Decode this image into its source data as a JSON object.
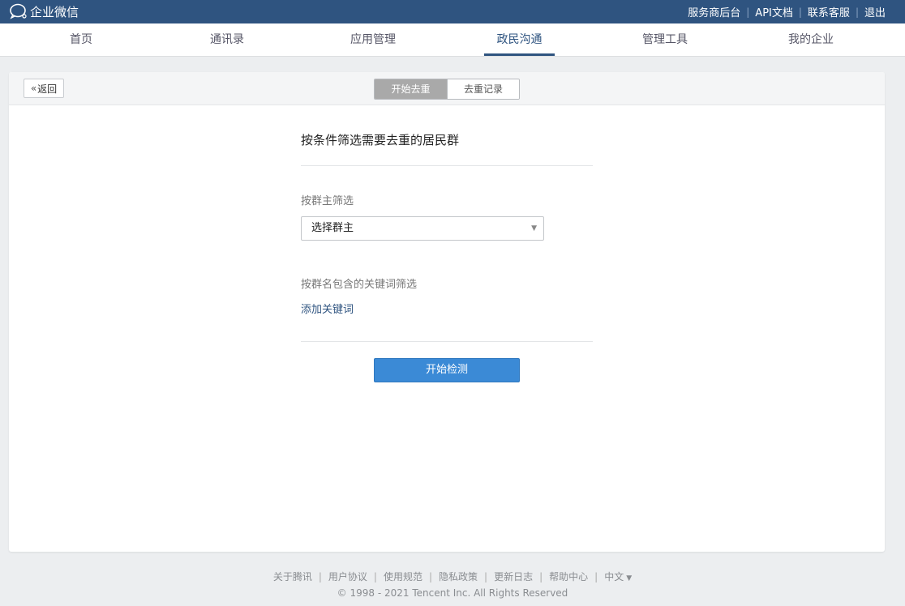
{
  "topbar": {
    "brand": "企业微信",
    "links": [
      "服务商后台",
      "API文档",
      "联系客服",
      "退出"
    ]
  },
  "nav": {
    "items": [
      "首页",
      "通讯录",
      "应用管理",
      "政民沟通",
      "管理工具",
      "我的企业"
    ],
    "active": "政民沟通"
  },
  "panel": {
    "back_label": "返回",
    "tabs": [
      "开始去重",
      "去重记录"
    ],
    "active_tab": "开始去重"
  },
  "form": {
    "title": "按条件筛选需要去重的居民群",
    "owner_label": "按群主筛选",
    "owner_select": "选择群主",
    "keyword_label": "按群名包含的关键词筛选",
    "add_keyword": "添加关键词",
    "start_button": "开始检测"
  },
  "footer": {
    "links": [
      "关于腾讯",
      "用户协议",
      "使用规范",
      "隐私政策",
      "更新日志",
      "帮助中心"
    ],
    "language": "中文",
    "copyright": "© 1998 - 2021 Tencent Inc. All Rights Reserved"
  },
  "colors": {
    "topbar": "#2f5480",
    "accent": "#2f5480",
    "primary_button": "#3b8ad6",
    "active_tab": "#a9a9a9"
  }
}
